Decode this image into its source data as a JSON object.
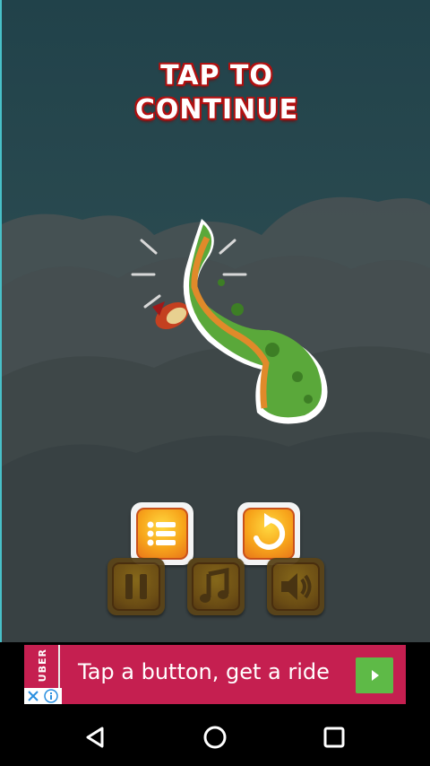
{
  "game": {
    "title_line1": "TAP TO",
    "title_line2": "CONTINUE",
    "buttons": [
      {
        "name": "menu-button",
        "icon": "list-icon"
      },
      {
        "name": "restart-button",
        "icon": "restart-icon"
      }
    ],
    "controls": [
      {
        "name": "pause-button",
        "icon": "pause-icon"
      },
      {
        "name": "music-button",
        "icon": "music-note-icon"
      },
      {
        "name": "sound-button",
        "icon": "speaker-icon"
      }
    ]
  },
  "ad": {
    "brand": "UBER",
    "text": "Tap a button, get a ride",
    "cta_icon": "play-arrow-icon",
    "close_icon": "close-icon",
    "info_icon": "info-icon"
  },
  "navbar": {
    "back_icon": "back-triangle-icon",
    "home_icon": "home-circle-icon",
    "recents_icon": "recents-square-icon"
  }
}
